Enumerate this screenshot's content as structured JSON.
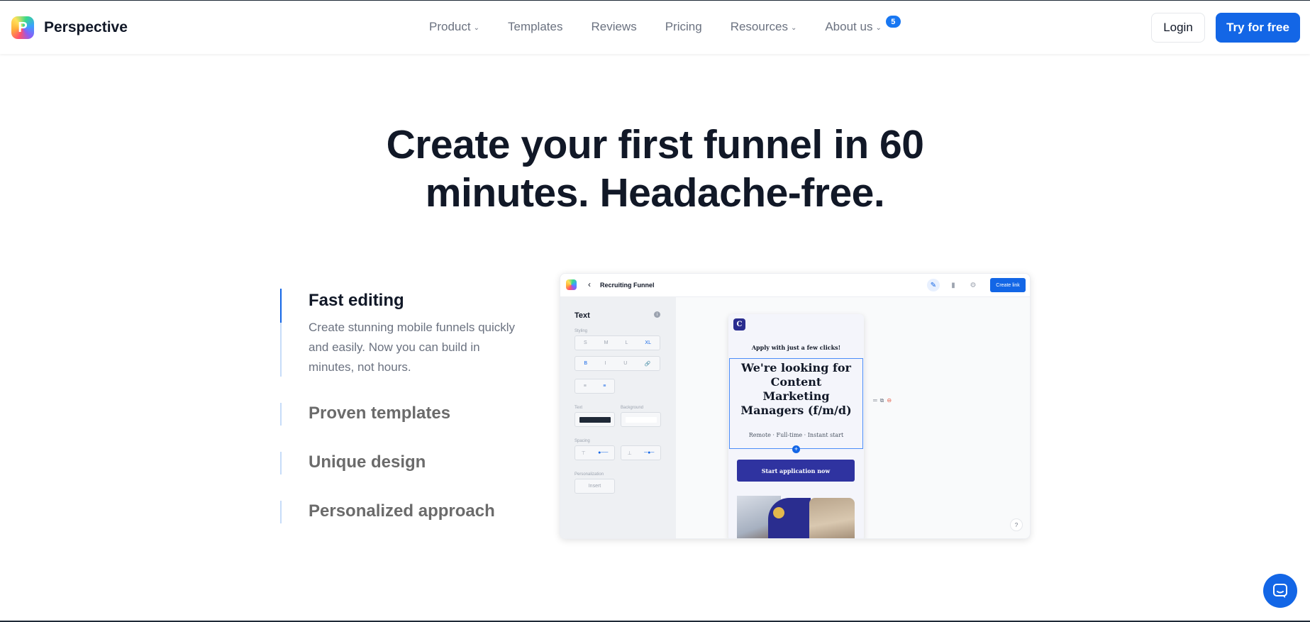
{
  "brand": {
    "name": "Perspective",
    "logo_letter": "P"
  },
  "nav": {
    "items": [
      {
        "label": "Product",
        "dropdown": true
      },
      {
        "label": "Templates",
        "dropdown": false
      },
      {
        "label": "Reviews",
        "dropdown": false
      },
      {
        "label": "Pricing",
        "dropdown": false
      },
      {
        "label": "Resources",
        "dropdown": true
      },
      {
        "label": "About us",
        "dropdown": true
      }
    ],
    "about_badge": "5",
    "login_label": "Login",
    "try_label": "Try for free"
  },
  "hero": {
    "title_line1": "Create your first funnel in 60",
    "title_line2": "minutes. Headache-free."
  },
  "features": [
    {
      "title": "Fast editing",
      "description": "Create stunning mobile funnels quickly and easily. Now you can build in minutes, not hours.",
      "active": true
    },
    {
      "title": "Proven templates",
      "active": false
    },
    {
      "title": "Unique design",
      "active": false
    },
    {
      "title": "Personalized approach",
      "active": false
    }
  ],
  "mockup": {
    "back_glyph": "‹",
    "funnel_title": "Recruiting Funnel",
    "create_link_label": "Create link",
    "panel": {
      "title": "Text",
      "styling_label": "Styling",
      "sizes": [
        "S",
        "M",
        "L",
        "XL"
      ],
      "active_size": "XL",
      "format_buttons": [
        "B",
        "I",
        "U",
        "🔗"
      ],
      "text_label": "Text",
      "background_label": "Background",
      "text_color": "#1f2937",
      "background_color": "#ffffff",
      "spacing_label": "Spacing",
      "personalization_label": "Personalization",
      "insert_label": "Insert"
    },
    "phone": {
      "logo_letter": "C",
      "apply_text": "Apply with just a few clicks!",
      "headline": "We're looking for Content Marketing Managers (f/m/d)",
      "subline": "Remote · Full-time · Instant start",
      "cta_label": "Start application now"
    },
    "help_glyph": "?"
  },
  "colors": {
    "accent": "#1366e6",
    "phone_brand": "#2f33a0"
  }
}
